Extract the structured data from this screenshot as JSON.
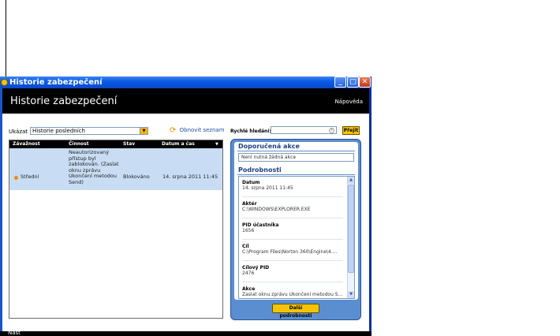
{
  "window": {
    "title": "Historie zabezpečení",
    "controls": {
      "minimize": "_",
      "maximize": "□",
      "close": "✕"
    }
  },
  "header": {
    "title": "Historie zabezpečení",
    "help": "Nápověda"
  },
  "filter": {
    "label": "Ukázat",
    "selected": "Historie posledních",
    "refresh_label": "Obnovit seznam"
  },
  "table": {
    "columns": [
      "Závažnost",
      "Činnost",
      "Stav",
      "Datum a čas"
    ],
    "rows": [
      {
        "severity": "Střední",
        "activity": [
          "Neautorizovaný",
          "přístup byl",
          "zablokován. (Zaslat",
          "oknu zprávu",
          "Ukončení metodou",
          "Send)"
        ],
        "status": "Blokováno",
        "datetime": "14. srpna 2011 11:45"
      }
    ]
  },
  "quick_search": {
    "label": "Rychlé hledání:",
    "value": "",
    "go_label": "Přejít"
  },
  "panel": {
    "recommended_heading": "Doporučená akce",
    "recommended_text": "Není nutná žádná akce",
    "details_heading": "Podrobnosti",
    "details": [
      {
        "label": "Datum",
        "value": "14. srpna 2011 11:45"
      },
      {
        "label": "Aktér",
        "value": "C:\\WINDOWS\\EXPLORER.EXE"
      },
      {
        "label": "PID účastníka",
        "value": "1656"
      },
      {
        "label": "Cíl",
        "value": "C:\\Program Files\\Norton 360\\Engine\\4...."
      },
      {
        "label": "Cílový PID",
        "value": "2476"
      },
      {
        "label": "Akce",
        "value": "Zaslat oknu zprávu Ukončení metodou S..."
      }
    ],
    "more_button": "Další podrobnosti"
  },
  "footer": {
    "text": "Nast"
  }
}
